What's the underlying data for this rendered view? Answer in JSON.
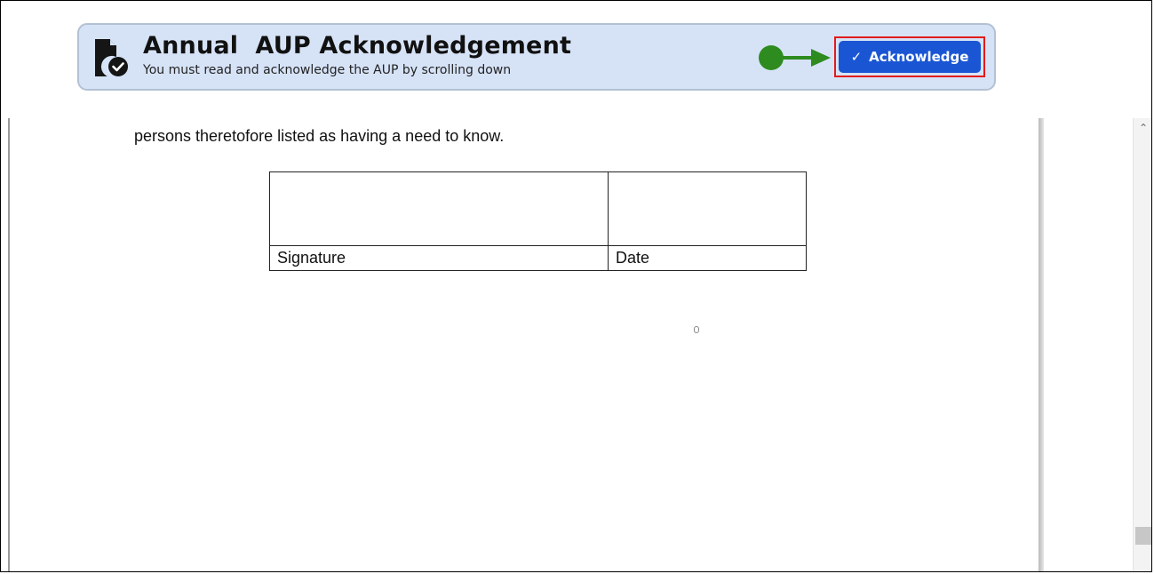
{
  "header": {
    "title": "Annual  AUP Acknowledgement",
    "subtitle": "You must read and acknowledge the AUP by scrolling down",
    "icon": "document-check-icon",
    "background_color": "#d6e3f7"
  },
  "acknowledge_button": {
    "label": "Acknowledge",
    "icon": "check-icon",
    "color": "#1a56d4",
    "highlight_color": "#e21b1b"
  },
  "annotation": {
    "pointer_color": "#2e8b1f",
    "pointer": "green-arrow-pointer"
  },
  "document": {
    "visible_text": "persons theretofore listed as having a need to know.",
    "table": {
      "labels": [
        "Signature",
        "Date"
      ]
    }
  },
  "scrollbar": {
    "up_arrow": "chevron-up-icon"
  }
}
